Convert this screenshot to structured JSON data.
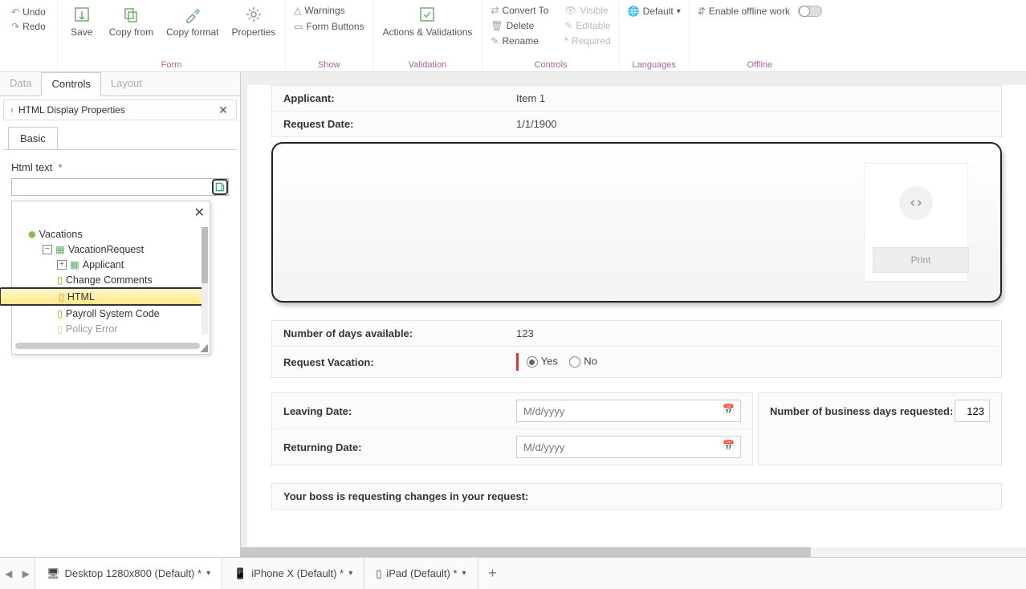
{
  "ribbon": {
    "undo": "Undo",
    "redo": "Redo",
    "save": "Save",
    "copy_from": "Copy from",
    "copy_format": "Copy format",
    "properties": "Properties",
    "group_form": "Form",
    "warnings": "Warnings",
    "form_buttons": "Form Buttons",
    "group_show": "Show",
    "actions_validations": "Actions & Validations",
    "group_validation": "Validation",
    "convert_to": "Convert To",
    "delete": "Delete",
    "rename": "Rename",
    "visible": "Visible",
    "editable": "Editable",
    "required": "Required",
    "group_controls": "Controls",
    "default": "Default",
    "group_languages": "Languages",
    "enable_offline": "Enable offline work",
    "group_offline": "Offline"
  },
  "left_tabs": {
    "data": "Data",
    "controls": "Controls",
    "layout": "Layout"
  },
  "panel": {
    "title": "HTML Display Properties",
    "tab_basic": "Basic",
    "html_text_label": "Html text"
  },
  "tree": {
    "root": "Vacations",
    "n1": "VacationRequest",
    "n2": "Applicant",
    "n3": "Change Comments",
    "n4": "HTML",
    "n5": "Payroll System Code",
    "n6": "Policy Error"
  },
  "form": {
    "applicant_label": "Applicant:",
    "applicant_value": "Item 1",
    "request_date_label": "Request Date:",
    "request_date_value": "1/1/1900",
    "print": "Print",
    "days_available_label": "Number of days available:",
    "days_available_value": "123",
    "request_vacation_label": "Request Vacation:",
    "yes": "Yes",
    "no": "No",
    "leaving_label": "Leaving Date:",
    "returning_label": "Returning Date:",
    "date_placeholder": "M/d/yyyy",
    "busdays_label": "Number of business days requested:",
    "busdays_value": "123",
    "boss_msg": "Your boss is requesting changes in your request:"
  },
  "devices": {
    "d1": "Desktop 1280x800 (Default) *",
    "d2": "iPhone X (Default) *",
    "d3": "iPad (Default) *"
  }
}
